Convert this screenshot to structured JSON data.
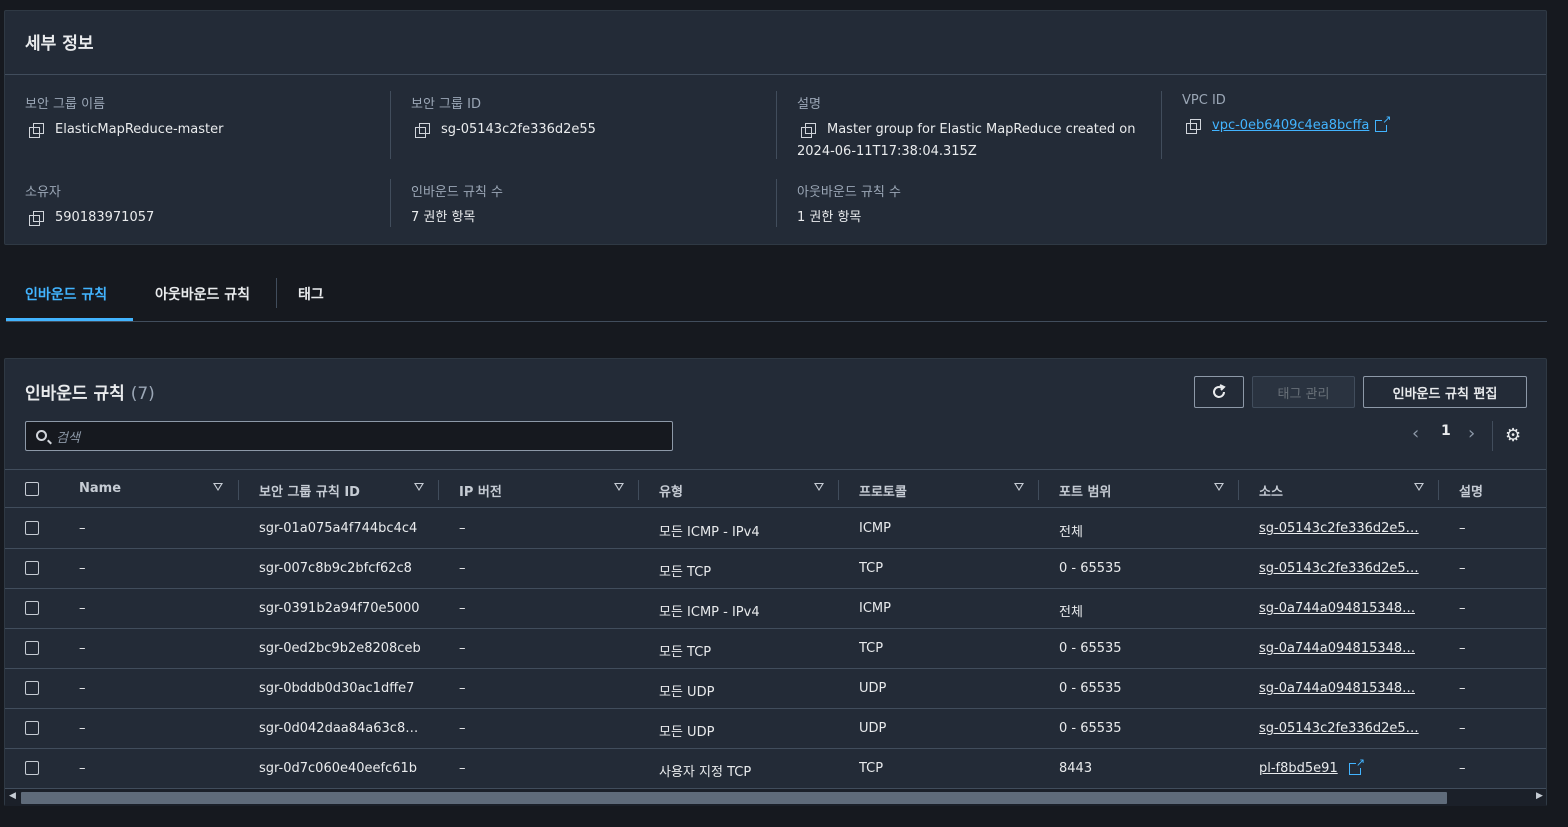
{
  "details": {
    "title": "세부 정보",
    "fields": [
      {
        "label": "보안 그룹 이름",
        "value": "ElasticMapReduce-master"
      },
      {
        "label": "보안 그룹 ID",
        "value": "sg-05143c2fe336d2e55"
      },
      {
        "label": "설명",
        "value": "Master group for Elastic MapReduce created on",
        "value2": "2024-06-11T17:38:04.315Z"
      },
      {
        "label": "VPC ID",
        "value": "vpc-0eb6409c4ea8bcffa"
      },
      {
        "label": "소유자",
        "value": "590183971057"
      },
      {
        "label": "인바운드 규칙 수",
        "value": "7 권한 항목"
      },
      {
        "label": "아웃바운드 규칙 수",
        "value": "1 권한 항목"
      }
    ]
  },
  "tabs": [
    {
      "label": "인바운드 규칙",
      "active": true
    },
    {
      "label": "아웃바운드 규칙",
      "active": false
    },
    {
      "label": "태그",
      "active": false
    }
  ],
  "rules": {
    "title": "인바운드 규칙",
    "count": "(7)",
    "manage_tags_label": "태그 관리",
    "edit_label": "인바운드 규칙 편집",
    "search_placeholder": "검색",
    "page": "1",
    "columns": [
      "Name",
      "보안 그룹 규칙 ID",
      "IP 버전",
      "유형",
      "프로토콜",
      "포트 범위",
      "소스",
      "설명"
    ],
    "rows": [
      {
        "name": "–",
        "id": "sgr-01a075a4f744bc4c4",
        "ip": "–",
        "type": "모든 ICMP - IPv4",
        "protocol": "ICMP",
        "port": "전체",
        "source": "sg-05143c2fe336d2e5…",
        "desc": "–"
      },
      {
        "name": "–",
        "id": "sgr-007c8b9c2bfcf62c8",
        "ip": "–",
        "type": "모든 TCP",
        "protocol": "TCP",
        "port": "0 - 65535",
        "source": "sg-05143c2fe336d2e5…",
        "desc": "–"
      },
      {
        "name": "–",
        "id": "sgr-0391b2a94f70e5000",
        "ip": "–",
        "type": "모든 ICMP - IPv4",
        "protocol": "ICMP",
        "port": "전체",
        "source": "sg-0a744a094815348…",
        "desc": "–"
      },
      {
        "name": "–",
        "id": "sgr-0ed2bc9b2e8208ceb",
        "ip": "–",
        "type": "모든 TCP",
        "protocol": "TCP",
        "port": "0 - 65535",
        "source": "sg-0a744a094815348…",
        "desc": "–"
      },
      {
        "name": "–",
        "id": "sgr-0bddb0d30ac1dffe7",
        "ip": "–",
        "type": "모든 UDP",
        "protocol": "UDP",
        "port": "0 - 65535",
        "source": "sg-0a744a094815348…",
        "desc": "–"
      },
      {
        "name": "–",
        "id": "sgr-0d042daa84a63c8…",
        "ip": "–",
        "type": "모든 UDP",
        "protocol": "UDP",
        "port": "0 - 65535",
        "source": "sg-05143c2fe336d2e5…",
        "desc": "–"
      },
      {
        "name": "–",
        "id": "sgr-0d7c060e40eefc61b",
        "ip": "–",
        "type": "사용자 지정 TCP",
        "protocol": "TCP",
        "port": "8443",
        "source": "pl-f8bd5e91",
        "desc": "–"
      }
    ]
  },
  "colors": {
    "accent": "#42b4ff",
    "panel": "#232b37",
    "background": "#16191f"
  }
}
